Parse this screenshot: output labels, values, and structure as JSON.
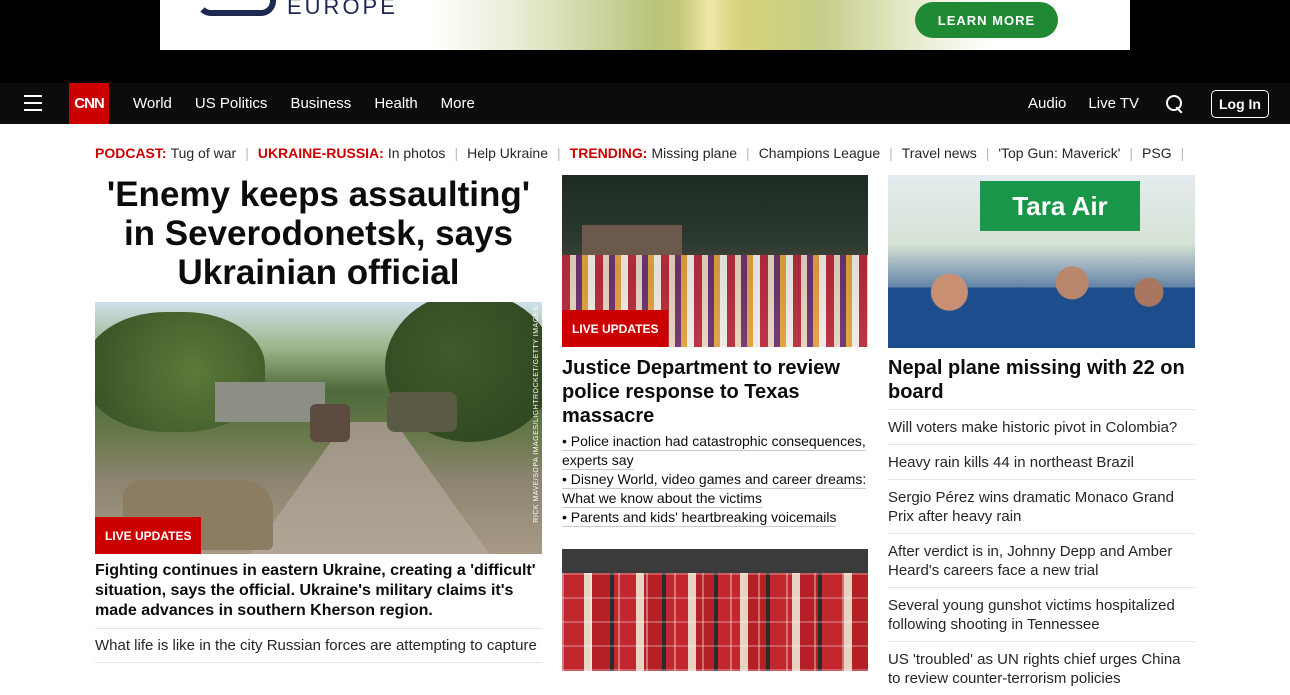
{
  "ad": {
    "brand": "EUROPE",
    "cta": "LEARN MORE"
  },
  "nav": {
    "logo": "CNN",
    "links": [
      "World",
      "US Politics",
      "Business",
      "Health",
      "More"
    ],
    "audio": "Audio",
    "live_tv": "Live TV",
    "login": "Log In"
  },
  "trending": [
    {
      "label": "PODCAST:",
      "text": "Tug of war"
    },
    {
      "label": "UKRAINE-RUSSIA:",
      "text": "In photos"
    },
    {
      "label": "",
      "text": "Help Ukraine"
    },
    {
      "label": "TRENDING:",
      "text": "Missing plane"
    },
    {
      "label": "",
      "text": "Champions League"
    },
    {
      "label": "",
      "text": "Travel news"
    },
    {
      "label": "",
      "text": "'Top Gun: Maverick'"
    },
    {
      "label": "",
      "text": "PSG"
    }
  ],
  "left": {
    "headline": "'Enemy keeps assaulting' in Severodonetsk, says Ukrainian official",
    "photo_credit": "RICK MAVE/SOPA IMAGES/LIGHTROCKET/GETTY IMAGES",
    "badge": "LIVE UPDATES",
    "summary": "Fighting continues in eastern Ukraine, creating a 'difficult' situation, says the official. Ukraine's military claims it's made advances in southern Kherson region.",
    "link": "What life is like in the city Russian forces are attempting to capture"
  },
  "middle": {
    "badge": "LIVE UPDATES",
    "headline": "Justice Department to review police response to Texas massacre",
    "bullets": [
      "• Police inaction had catastrophic consequences, experts say",
      "• Disney World, video games and career dreams: What we know about the victims",
      "• Parents and kids' heartbreaking voicemails"
    ]
  },
  "right": {
    "sign": "Tara Air",
    "headline": "Nepal plane missing with 22 on board",
    "items": [
      "Will voters make historic pivot in Colombia?",
      "Heavy rain kills 44 in northeast Brazil",
      "Sergio Pérez wins dramatic Monaco Grand Prix after heavy rain",
      "After verdict is in, Johnny Depp and Amber Heard's careers face a new trial",
      "Several young gunshot victims hospitalized following shooting in Tennessee",
      "US 'troubled' as UN rights chief urges China to review counter-terrorism policies"
    ]
  }
}
